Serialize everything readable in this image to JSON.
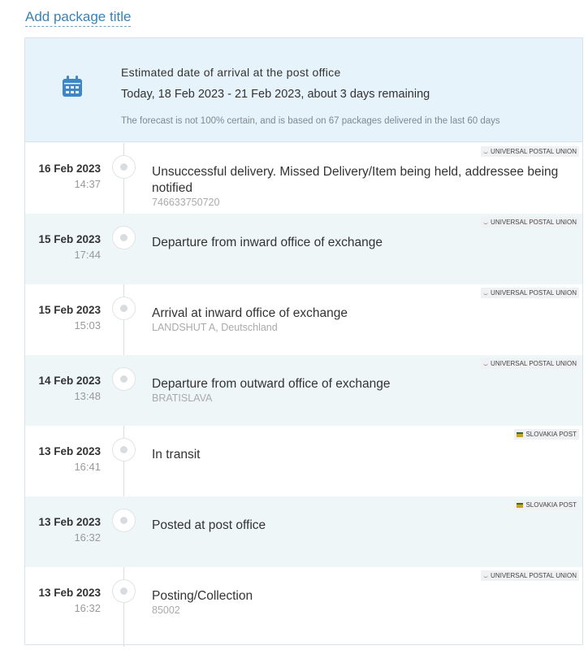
{
  "header": {
    "add_title_link": "Add package title"
  },
  "forecast": {
    "icon": "calendar-icon",
    "label": "Estimated date of arrival at the post office",
    "range": "Today, 18 Feb 2023 - 21 Feb 2023, about 3 days remaining",
    "note": "The forecast is not 100% certain, and is based on 67 packages delivered in the last 60 days"
  },
  "events": [
    {
      "date": "16 Feb 2023",
      "time": "14:37",
      "status": "Unsuccessful delivery. Missed Delivery/Item being held, addressee being notified",
      "detail": "746633750720",
      "carrier": "Universal Postal Union",
      "carrier_icon": "upu-logo-icon"
    },
    {
      "date": "15 Feb 2023",
      "time": "17:44",
      "status": "Departure from inward office of exchange",
      "detail": "",
      "carrier": "Universal Postal Union",
      "carrier_icon": "upu-logo-icon"
    },
    {
      "date": "15 Feb 2023",
      "time": "15:03",
      "status": "Arrival at inward office of exchange",
      "detail": "LANDSHUT A, Deutschland",
      "carrier": "Universal Postal Union",
      "carrier_icon": "upu-logo-icon"
    },
    {
      "date": "14 Feb 2023",
      "time": "13:48",
      "status": "Departure from outward office of exchange",
      "detail": "BRATISLAVA",
      "carrier": "Universal Postal Union",
      "carrier_icon": "upu-logo-icon"
    },
    {
      "date": "13 Feb 2023",
      "time": "16:41",
      "status": "In transit",
      "detail": "",
      "carrier": "Slovakia Post",
      "carrier_icon": "slovakia-post-logo-icon"
    },
    {
      "date": "13 Feb 2023",
      "time": "16:32",
      "status": "Posted at post office",
      "detail": "",
      "carrier": "Slovakia Post",
      "carrier_icon": "slovakia-post-logo-icon"
    },
    {
      "date": "13 Feb 2023",
      "time": "16:32",
      "status": "Posting/Collection",
      "detail": "85002",
      "carrier": "Universal Postal Union",
      "carrier_icon": "upu-logo-icon"
    }
  ]
}
